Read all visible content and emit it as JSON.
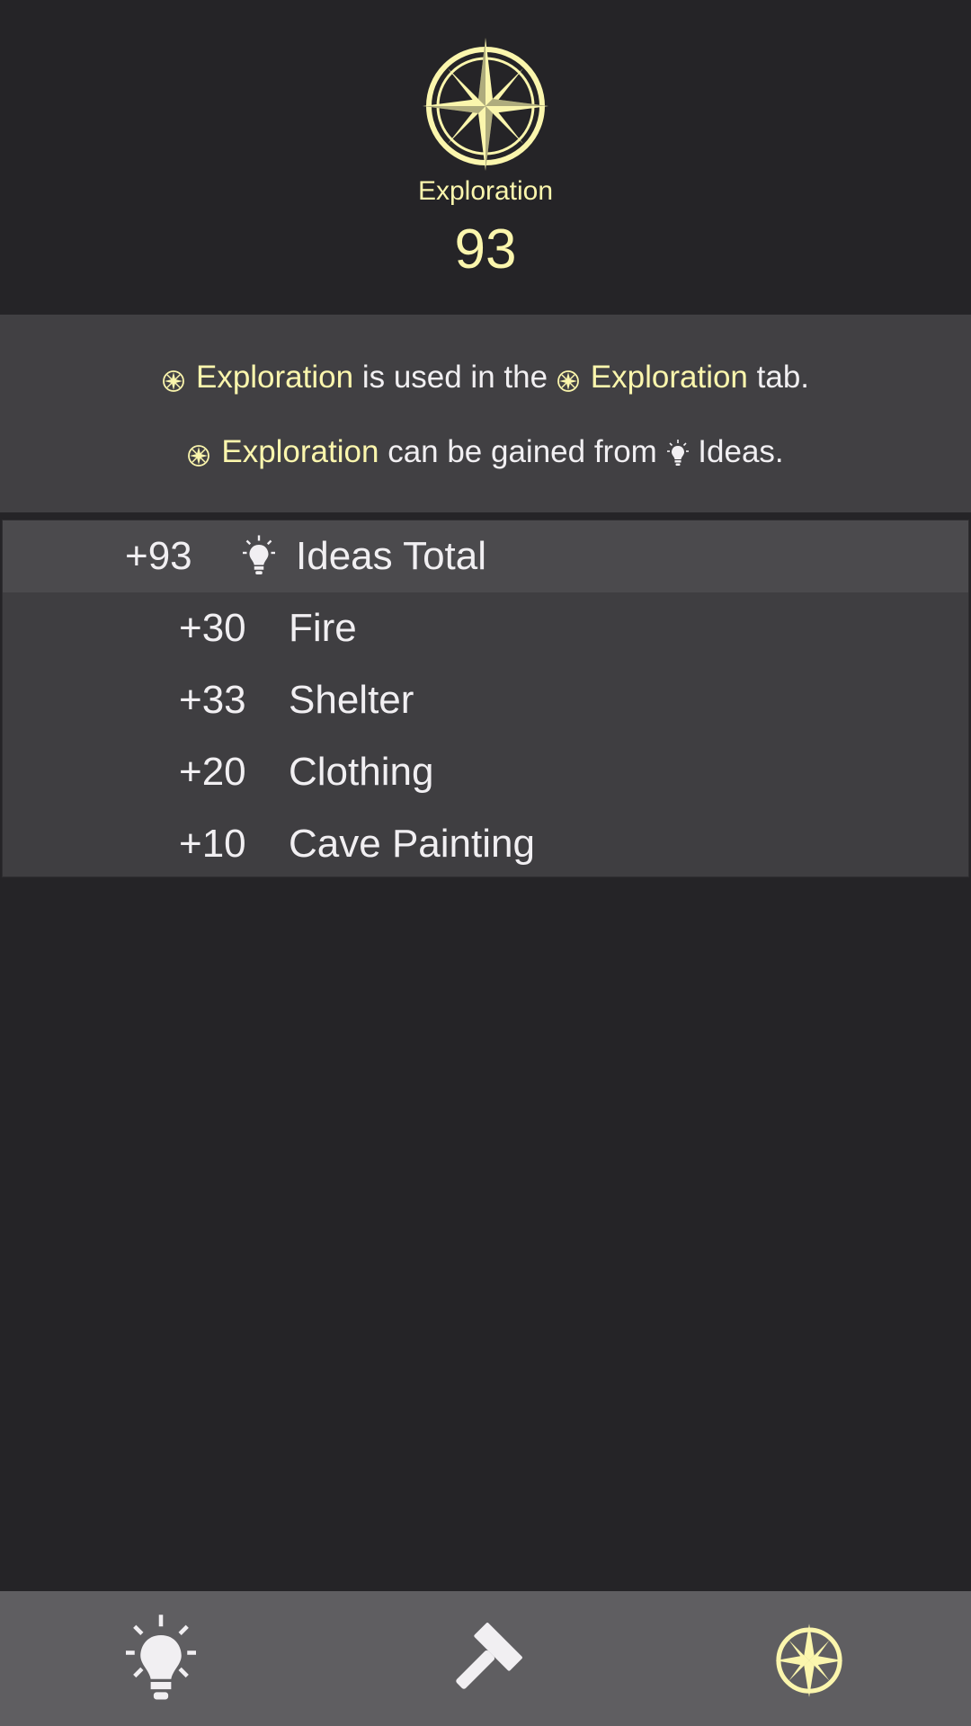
{
  "header": {
    "icon": "compass-rose-icon",
    "title": "Exploration",
    "value": "93"
  },
  "info": {
    "line1": {
      "resource": "Exploration",
      "mid": "is used in the",
      "tab": "Exploration",
      "end": "tab."
    },
    "line2": {
      "resource": "Exploration",
      "mid": "can be gained from",
      "source": "Ideas."
    }
  },
  "breakdown": {
    "total": {
      "value": "+93",
      "icon": "lightbulb-icon",
      "label": "Ideas Total"
    },
    "rows": [
      {
        "value": "+30",
        "label": "Fire"
      },
      {
        "value": "+33",
        "label": "Shelter"
      },
      {
        "value": "+20",
        "label": "Clothing"
      },
      {
        "value": "+10",
        "label": "Cave Painting"
      }
    ]
  },
  "nav": {
    "items": [
      {
        "icon": "lightbulb-icon"
      },
      {
        "icon": "hammer-icon"
      },
      {
        "icon": "compass-rose-icon"
      }
    ]
  },
  "colors": {
    "accent": "#fbf6ad",
    "background": "#252427",
    "panel": "#414043",
    "nav": "#5f5e61"
  }
}
